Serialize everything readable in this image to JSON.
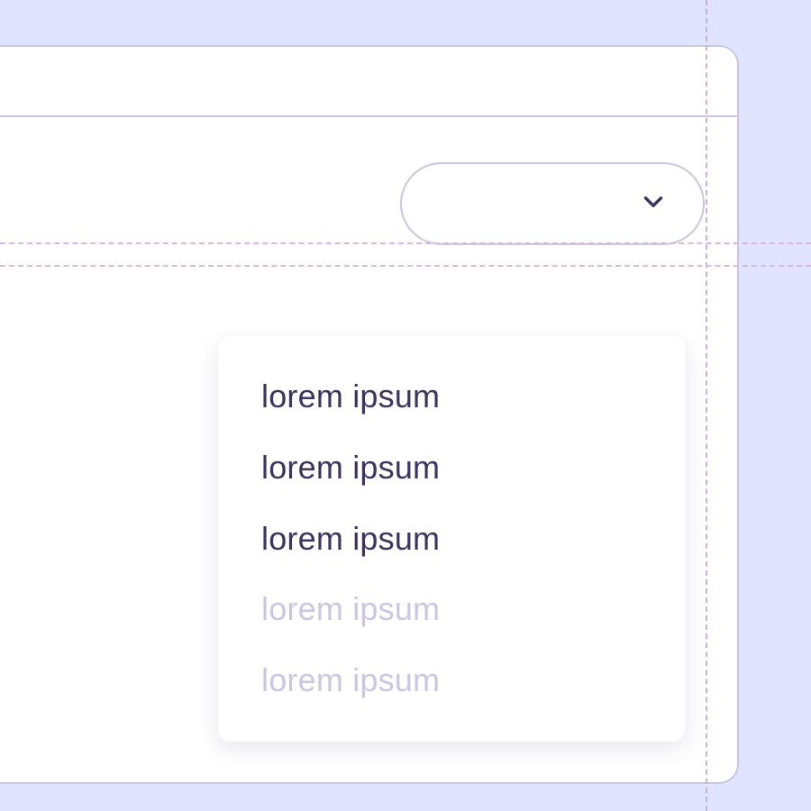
{
  "dropdown": {
    "options": [
      {
        "label": "lorem ipsum",
        "enabled": true
      },
      {
        "label": "lorem ipsum",
        "enabled": true
      },
      {
        "label": "lorem ipsum",
        "enabled": true
      },
      {
        "label": "lorem ipsum",
        "enabled": false
      },
      {
        "label": "lorem ipsum",
        "enabled": false
      }
    ]
  }
}
